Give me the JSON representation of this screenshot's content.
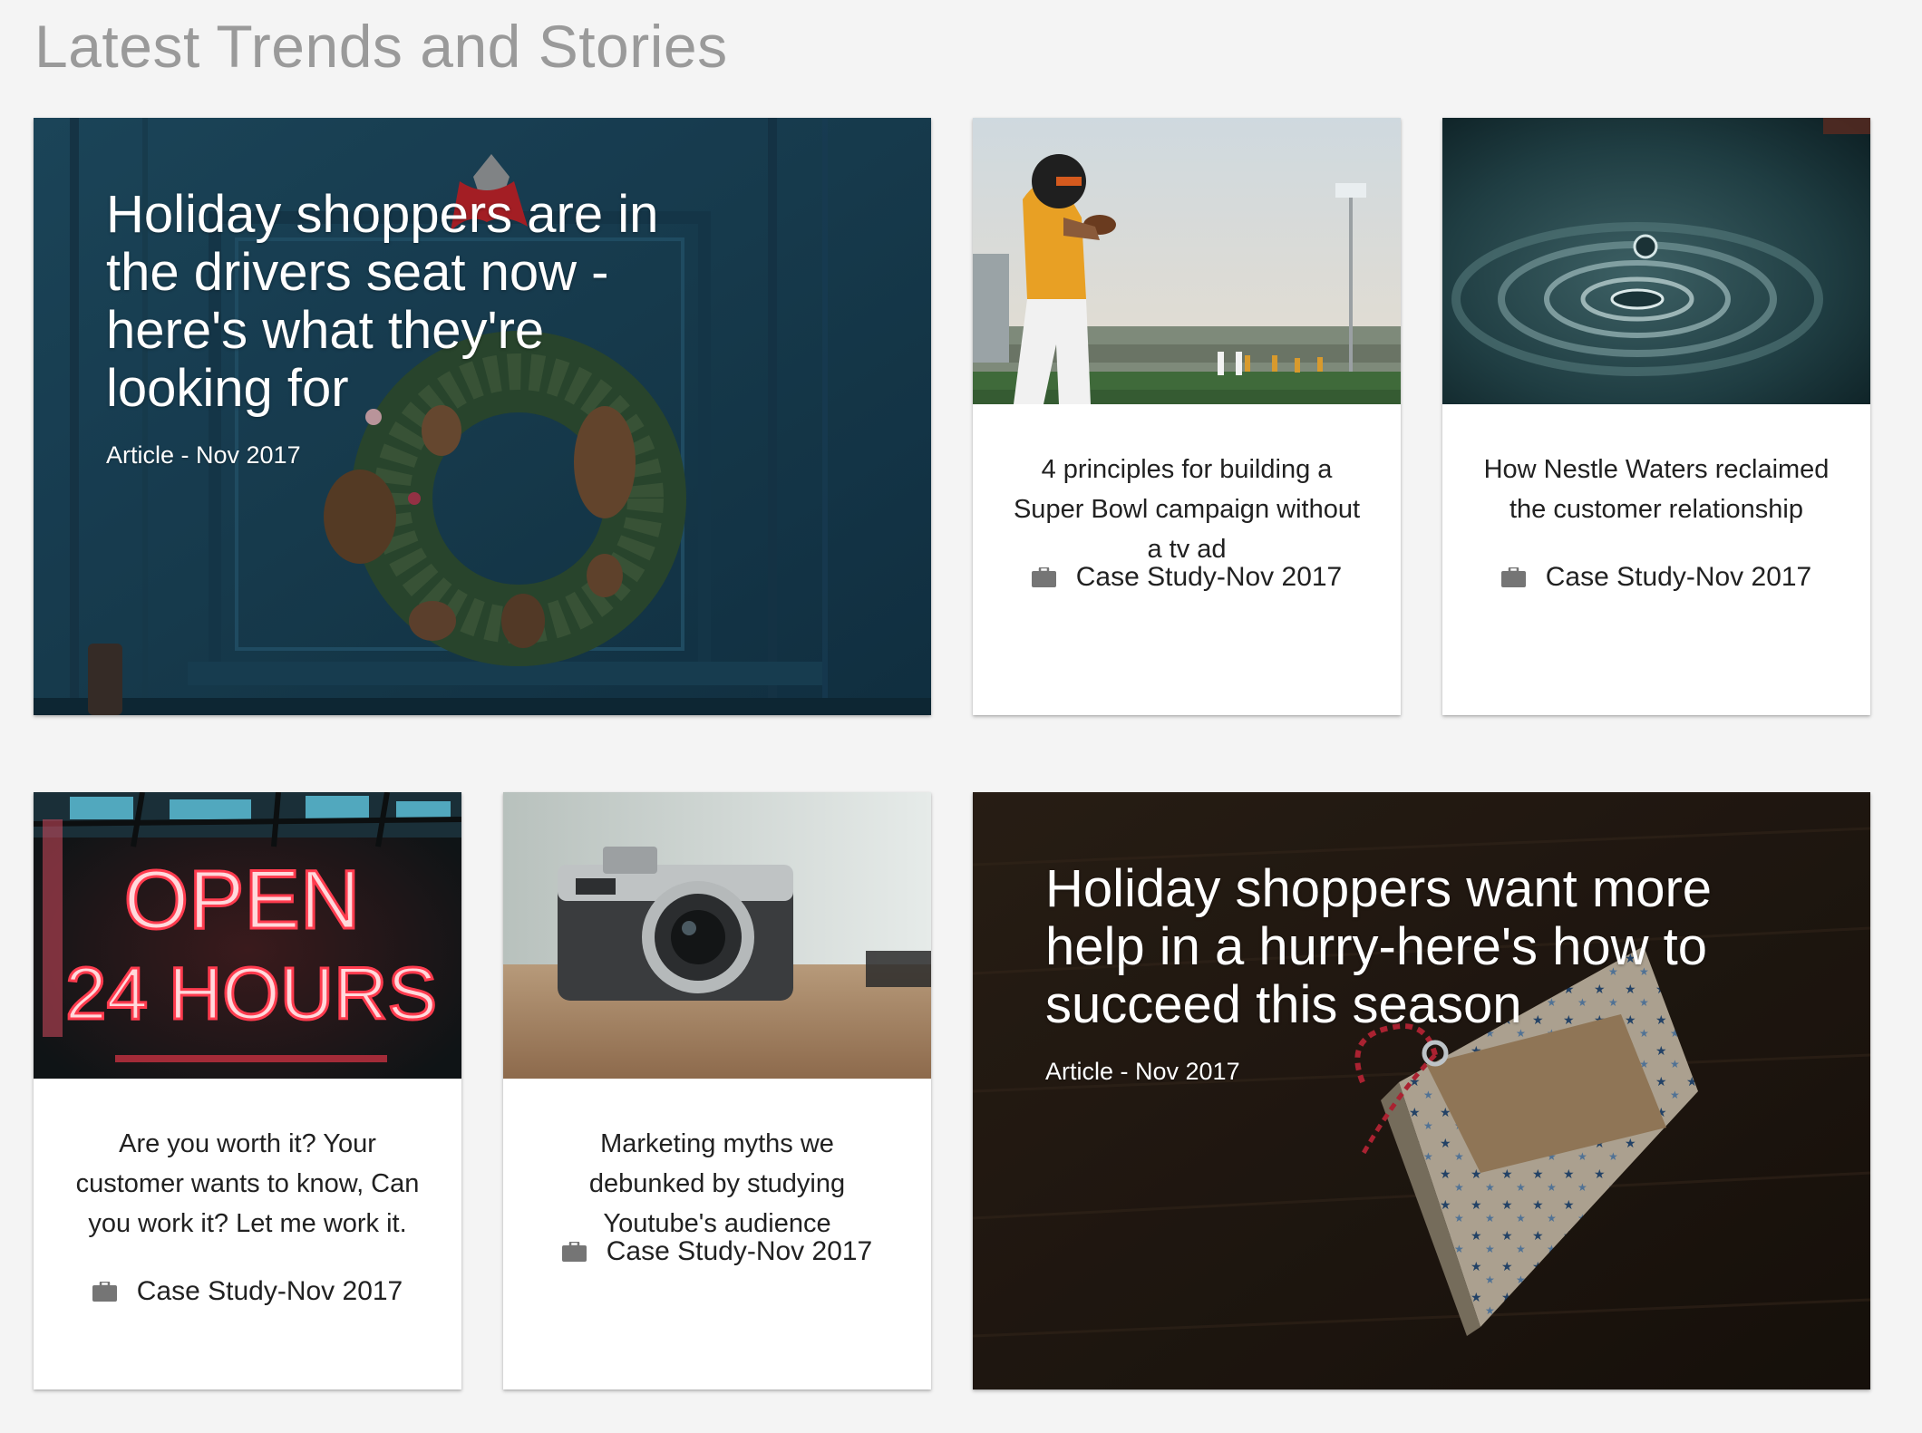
{
  "page": {
    "title": "Latest Trends and Stories"
  },
  "colors": {
    "background": "#f4f4f4",
    "heading": "#9a9a9a",
    "card_text": "#212121",
    "icon": "#757575"
  },
  "cards": [
    {
      "type": "feature",
      "title": "Holiday shoppers are in the drivers seat now - here's what they're looking for",
      "meta": "Article - Nov 2017",
      "image": "blue-door-with-christmas-wreath"
    },
    {
      "type": "case-study",
      "title": "4 principles for building a Super Bowl campaign without a tv ad",
      "meta": "Case Study-Nov 2017",
      "icon": "briefcase-icon",
      "image": "football-quarterback"
    },
    {
      "type": "case-study",
      "title": "How Nestle Waters reclaimed the customer relationship",
      "meta": "Case Study-Nov 2017",
      "icon": "briefcase-icon",
      "image": "water-droplet-ripples"
    },
    {
      "type": "case-study",
      "title": "Are you worth it? Your customer wants to know, Can you work it? Let me work it.",
      "meta": "Case Study-Nov 2017",
      "icon": "briefcase-icon",
      "image": "neon-open-sign",
      "image_text": [
        "OPEN",
        "24 HOURS"
      ]
    },
    {
      "type": "case-study",
      "title": "Marketing myths we debunked by studying Youtube's audience",
      "meta": "Case Study-Nov 2017",
      "icon": "briefcase-icon",
      "image": "vintage-camera"
    },
    {
      "type": "feature",
      "title": "Holiday shoppers want more help in a hurry-here's how to succeed this season",
      "meta": "Article - Nov 2017",
      "image": "wrapped-gift-with-tag"
    }
  ]
}
